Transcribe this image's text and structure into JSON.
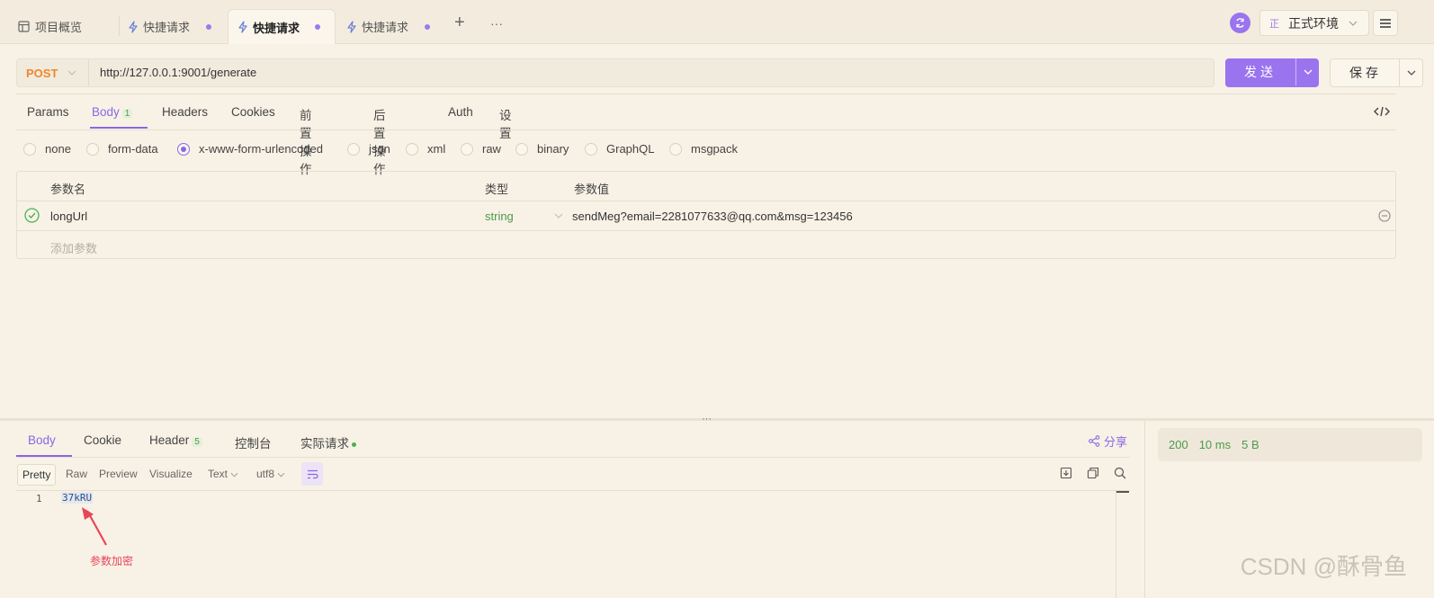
{
  "tabs": {
    "overview_label": "项目概览",
    "items": [
      {
        "label": "快捷请求"
      },
      {
        "label": "快捷请求"
      },
      {
        "label": "快捷请求"
      }
    ],
    "add_symbol": "+",
    "more_symbol": "···"
  },
  "env": {
    "badge": "正",
    "label": "正式环境"
  },
  "request": {
    "method": "POST",
    "url": "http://127.0.0.1:9001/generate",
    "send_label": "发送",
    "save_label": "保存"
  },
  "request_tabs": [
    {
      "label": "Params"
    },
    {
      "label": "Body",
      "badge": "1"
    },
    {
      "label": "Headers"
    },
    {
      "label": "Cookies"
    },
    {
      "label": "前置操作"
    },
    {
      "label": "后置操作"
    },
    {
      "label": "Auth"
    },
    {
      "label": "设置"
    }
  ],
  "body_types": [
    {
      "label": "none"
    },
    {
      "label": "form-data"
    },
    {
      "label": "x-www-form-urlencoded",
      "checked": true
    },
    {
      "label": "json"
    },
    {
      "label": "xml"
    },
    {
      "label": "raw"
    },
    {
      "label": "binary"
    },
    {
      "label": "GraphQL"
    },
    {
      "label": "msgpack"
    }
  ],
  "params_table": {
    "headers": {
      "name": "参数名",
      "type": "类型",
      "value": "参数值"
    },
    "rows": [
      {
        "name": "longUrl",
        "type": "string",
        "value": "sendMeg?email=2281077633@qq.com&msg=123456"
      }
    ],
    "add_placeholder": "添加参数"
  },
  "response": {
    "tabs": [
      {
        "label": "Body"
      },
      {
        "label": "Cookie"
      },
      {
        "label": "Header",
        "badge": "5"
      },
      {
        "label": "控制台"
      },
      {
        "label": "实际请求"
      }
    ],
    "share_label": "分享",
    "view_modes": [
      "Pretty",
      "Raw",
      "Preview",
      "Visualize"
    ],
    "format": "Text",
    "encoding": "utf8",
    "code_lines": [
      {
        "num": "1",
        "text": "37kRU"
      }
    ],
    "annotation": "参数加密",
    "status": {
      "code": "200",
      "time": "10 ms",
      "size": "5 B"
    }
  },
  "watermark": "CSDN @酥骨鱼",
  "colors": {
    "accent": "#9a74ef",
    "method": "#f0872e",
    "success": "#4c9a4c",
    "annotation": "#e8455a",
    "background": "#f8f2e6"
  }
}
